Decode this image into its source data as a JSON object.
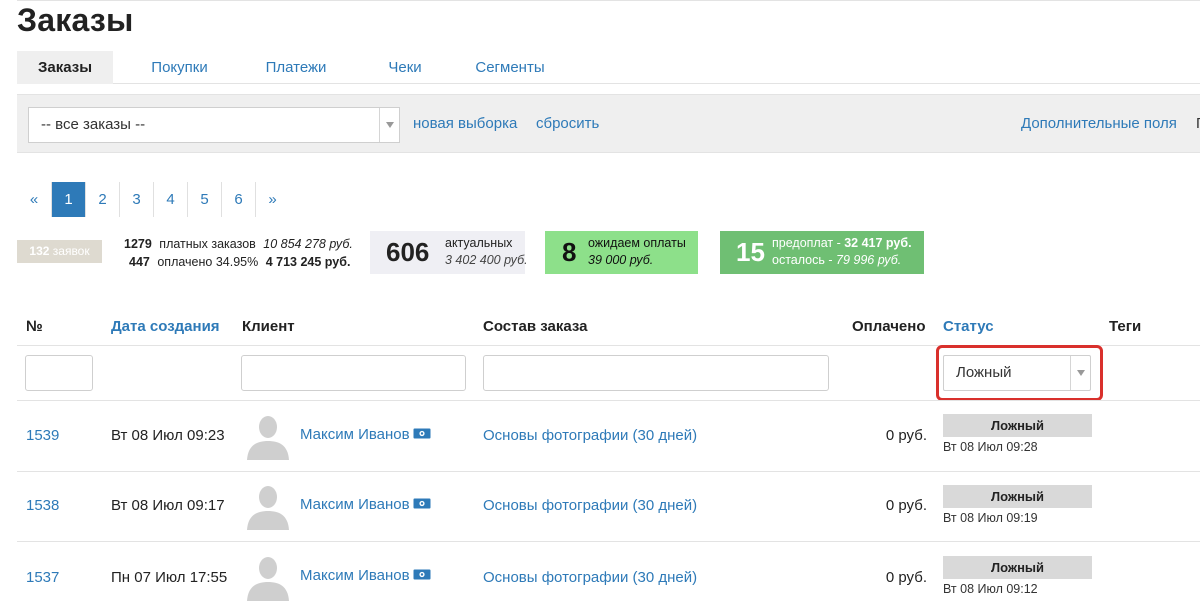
{
  "page": {
    "title": "Заказы"
  },
  "tabs": [
    {
      "label": "Заказы",
      "active": true
    },
    {
      "label": "Покупки"
    },
    {
      "label": "Платежи"
    },
    {
      "label": "Чеки"
    },
    {
      "label": "Сегменты"
    }
  ],
  "filter": {
    "select_value": "-- все заказы --",
    "new_selection": "новая выборка",
    "reset": "сбросить",
    "extra_fields": "Дополнительные поля",
    "cut_text": "П"
  },
  "pagination": {
    "prev": "«",
    "pages": [
      "1",
      "2",
      "3",
      "4",
      "5",
      "6"
    ],
    "next": "»",
    "current": "1"
  },
  "stats": {
    "orders_badge": {
      "count": "132",
      "label": "заявок"
    },
    "paid_orders": {
      "count": "1279",
      "label": "платных заказов",
      "sum": "10 854 278 руб."
    },
    "paid_percent": {
      "count": "447",
      "label": "оплачено 34.95%",
      "sum": "4 713 245 руб."
    },
    "actual": {
      "count": "606",
      "label": "актуальных",
      "sum": "3 402 400 руб."
    },
    "awaiting": {
      "count": "8",
      "label": "ожидаем оплаты",
      "sum": "39 000 руб."
    },
    "prepaid": {
      "count": "15",
      "label_prefix": "предоплат - ",
      "label_sum": "32 417 руб.",
      "rest_prefix": "осталось - ",
      "rest_sum": "79 996 руб."
    }
  },
  "table": {
    "columns": {
      "number": "№",
      "created": "Дата создания",
      "client": "Клиент",
      "composition": "Состав заказа",
      "paid": "Оплачено",
      "status": "Статус",
      "tags": "Теги"
    },
    "status_filter_value": "Ложный",
    "rows": [
      {
        "id": "1539",
        "created": "Вт 08 Июл 09:23",
        "client": "Максим Иванов",
        "composition": "Основы фотографии (30 дней)",
        "paid": "0 руб.",
        "status": "Ложный",
        "status_time": "Вт 08 Июл 09:28"
      },
      {
        "id": "1538",
        "created": "Вт 08 Июл 09:17",
        "client": "Максим Иванов",
        "composition": "Основы фотографии (30 дней)",
        "paid": "0 руб.",
        "status": "Ложный",
        "status_time": "Вт 08 Июл 09:19"
      },
      {
        "id": "1537",
        "created": "Пн 07 Июл 17:55",
        "client": "Максим Иванов",
        "composition": "Основы фотографии (30 дней)",
        "paid": "0 руб.",
        "status": "Ложный",
        "status_time": "Вт 08 Июл 09:12"
      }
    ]
  },
  "colors": {
    "link": "#2e7ab8",
    "awaiting_bg": "#8de08a",
    "prepaid_bg": "#6fbf73",
    "actual_bg": "#efeff4",
    "status_badge_bg": "#d9d9d9",
    "highlight_border": "#d9302c"
  },
  "icons": {
    "avatar": "user-silhouette-icon",
    "client_money": "money-icon"
  }
}
